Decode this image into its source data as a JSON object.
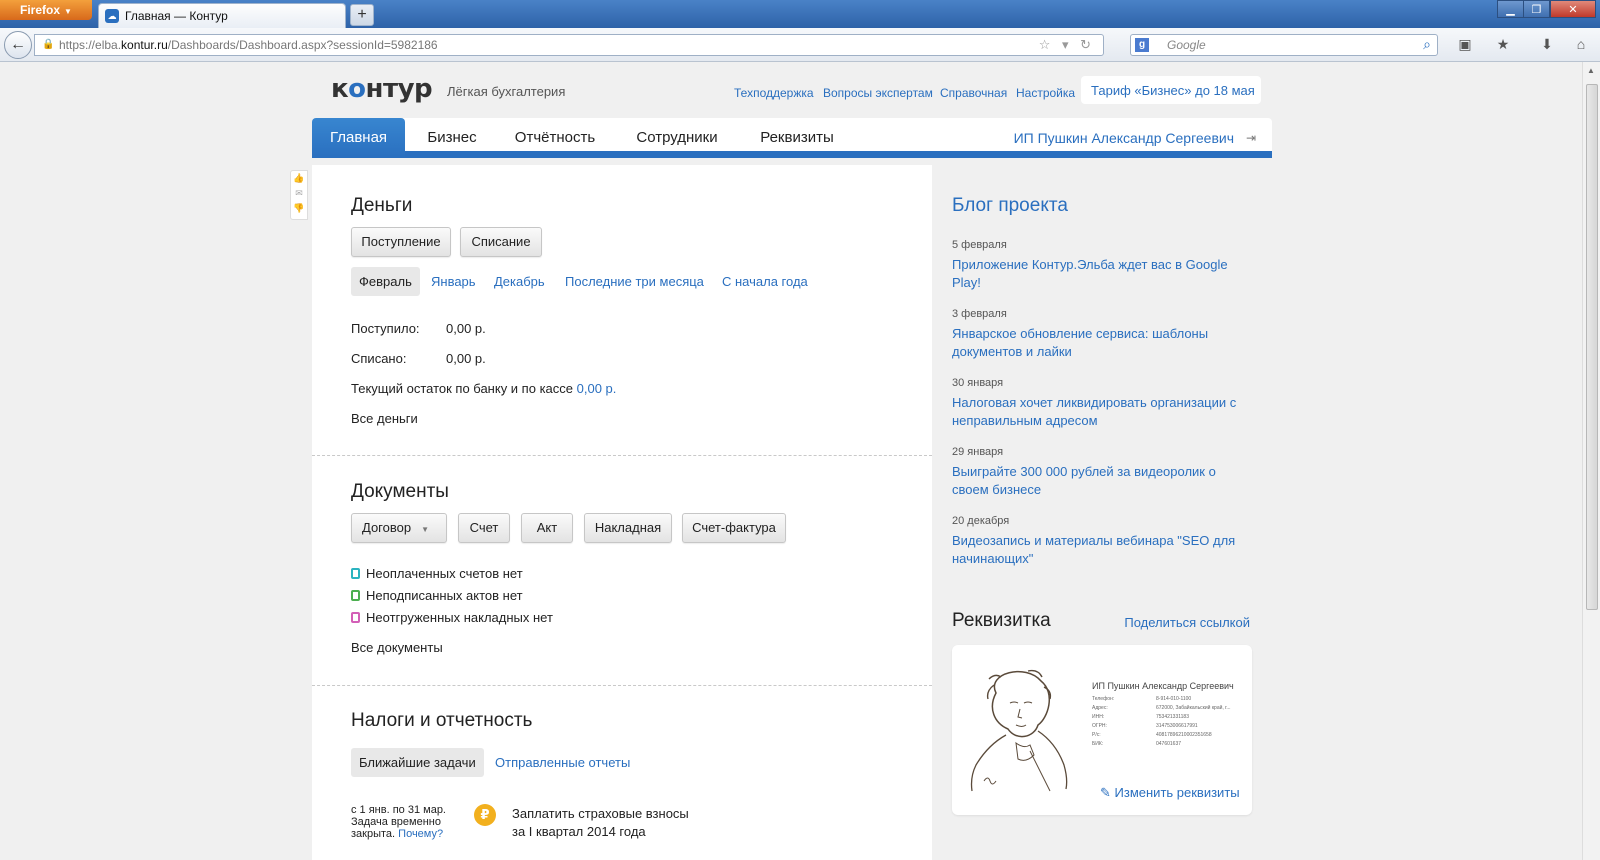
{
  "browser": {
    "menu_label": "Firefox",
    "tab_title": "Главная — Контур",
    "new_tab": "+",
    "url_prefix": "https://elba.",
    "url_host": "kontur.ru",
    "url_path": "/Dashboards/Dashboard.aspx?sessionId=5982186",
    "search_placeholder": "Google"
  },
  "header": {
    "logo_pre": "к",
    "logo_cloud": "о",
    "logo_post": "нтур",
    "tagline": "Лёгкая бухгалтерия",
    "links": [
      "Техподдержка",
      "Вопросы экспертам",
      "Справочная",
      "Настройка"
    ],
    "tariff": "Тариф «Бизнес» до 18 мая"
  },
  "nav": {
    "items": [
      "Главная",
      "Бизнес",
      "Отчётность",
      "Сотрудники",
      "Реквизиты"
    ],
    "active": "Главная",
    "user": "ИП Пушкин Александр Сергеевич"
  },
  "money": {
    "title": "Деньги",
    "buttons": [
      "Поступление",
      "Списание"
    ],
    "periods": [
      "Февраль",
      "Январь",
      "Декабрь",
      "Последние три месяца",
      "С начала года"
    ],
    "income_label": "Поступило:",
    "income_value": "0,00 р.",
    "spent_label": "Списано:",
    "spent_value": "0,00 р.",
    "balance_label": "Текущий остаток по банку и по кассе",
    "balance_value": "0,00 р.",
    "all_link": "Все деньги"
  },
  "documents": {
    "title": "Документы",
    "buttons": [
      "Договор",
      "Счет",
      "Акт",
      "Накладная",
      "Счет-фактура"
    ],
    "statuses": [
      "Неоплаченных счетов нет",
      "Неподписанных актов нет",
      "Неотгруженных накладных нет"
    ],
    "status_colors": [
      "#2bb3c0",
      "#4caf50",
      "#d35fb7"
    ],
    "all_link": "Все документы"
  },
  "taxes": {
    "title": "Налоги и отчетность",
    "tabs": [
      "Ближайшие задачи",
      "Отправленные отчеты"
    ],
    "task_dates": "с 1 янв. по 31 мар.",
    "task_status": "Задача временно",
    "task_status2": "закрыта.",
    "why_link": "Почему?",
    "coin_symbol": "₽",
    "task_line1": "Заплатить страховые взносы",
    "task_line2": "за I квартал 2014 года"
  },
  "blog": {
    "title": "Блог проекта",
    "posts": [
      {
        "date": "5 февраля",
        "title": "Приложение Контур.Эльба ждет вас в Google Play!"
      },
      {
        "date": "3 февраля",
        "title": "Январское обновление сервиса: шаблоны документов и лайки"
      },
      {
        "date": "30 января",
        "title": "Налоговая хочет ликвидировать организации с неправильным адресом"
      },
      {
        "date": "29 января",
        "title": "Выиграйте 300 000 рублей за видеоролик о своем бизнесе"
      },
      {
        "date": "20 декабря",
        "title": "Видеозапись и материалы вебинара \"SEO для начинающих\""
      }
    ]
  },
  "requisites": {
    "title": "Реквизитка",
    "share_link": "Поделиться ссылкой",
    "card_name": "ИП Пушкин Александр Сергеевич",
    "rows": [
      {
        "label": "Телефон:",
        "value": "8-914-010-1100"
      },
      {
        "label": "Адрес:",
        "value": "672000, Забайкальский край, г..."
      },
      {
        "label": "ИНН:",
        "value": "753421331183"
      },
      {
        "label": "ОГРН:",
        "value": "314753006617991"
      },
      {
        "label": "Р/с:",
        "value": "40817896210002351658"
      },
      {
        "label": "БИК:",
        "value": "047601637"
      }
    ],
    "edit_link": "Изменить реквизиты"
  }
}
